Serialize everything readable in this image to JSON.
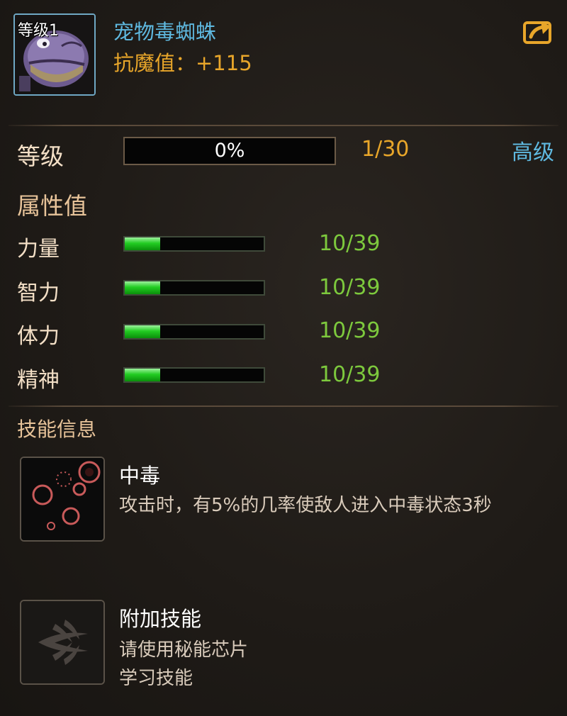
{
  "pet": {
    "level_badge": "等级1",
    "name": "宠物毒蜘蛛",
    "stat_line": "抗魔值：+115"
  },
  "share_icon": "share-arrow-icon",
  "level_row": {
    "label": "等级",
    "progress_text": "0%",
    "progress": 0,
    "count": "1/30",
    "advanced_label": "高级"
  },
  "attributes": {
    "title": "属性值",
    "items": [
      {
        "label": "力量",
        "value": "10/39",
        "fill": 0.2564
      },
      {
        "label": "智力",
        "value": "10/39",
        "fill": 0.2564
      },
      {
        "label": "体力",
        "value": "10/39",
        "fill": 0.2564
      },
      {
        "label": "精神",
        "value": "10/39",
        "fill": 0.2564
      }
    ]
  },
  "skills": {
    "title": "技能信息",
    "items": [
      {
        "name": "中毒",
        "icon": "poison-bubbles-icon",
        "desc_lines": [
          "攻击时，有5%的几率使敌人进入中毒状态3秒"
        ]
      },
      {
        "name": "附加技能",
        "icon": "locked-skill-icon",
        "desc_lines": [
          "请使用秘能芯片",
          "学习技能"
        ]
      }
    ]
  },
  "colors": {
    "accent_blue": "#5fb9e0",
    "accent_orange": "#e8a62a",
    "attr_green": "#7dc93d",
    "bar_fill_green": "#22cc22"
  }
}
